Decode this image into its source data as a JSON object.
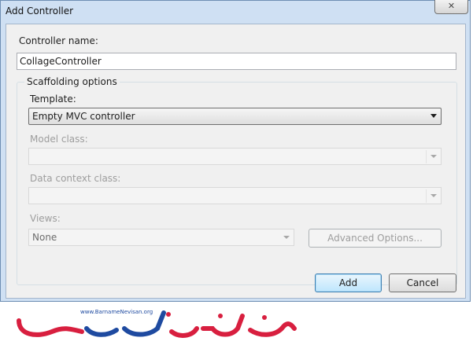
{
  "window": {
    "title": "Add Controller",
    "close_glyph": "✕"
  },
  "controller_name": {
    "label": "Controller name:",
    "value": "CollageController"
  },
  "scaffolding": {
    "legend": "Scaffolding options",
    "template": {
      "label": "Template:",
      "selected": "Empty MVC controller"
    },
    "model_class": {
      "label": "Model class:",
      "selected": ""
    },
    "data_context_class": {
      "label": "Data context class:",
      "selected": ""
    },
    "views": {
      "label": "Views:",
      "selected": "None"
    },
    "advanced_button": "Advanced Options..."
  },
  "buttons": {
    "add": "Add",
    "cancel": "Cancel"
  },
  "watermark": {
    "url": "www.BarnameNevisan.org"
  },
  "colors": {
    "logo_red": "#d81f3f",
    "logo_blue": "#1e4aa0",
    "default_button_border": "#3c7fb1"
  }
}
